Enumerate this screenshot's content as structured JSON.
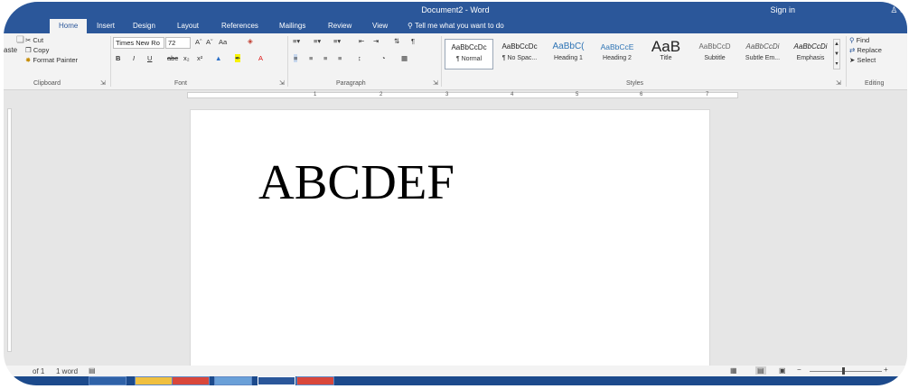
{
  "window": {
    "title": "Document2 - Word",
    "sign_in": "Sign in",
    "share_initial": "S"
  },
  "tabs": [
    "Home",
    "Insert",
    "Design",
    "Layout",
    "References",
    "Mailings",
    "Review",
    "View"
  ],
  "tell_me": "Tell me what you want to do",
  "clipboard": {
    "paste": "aste",
    "cut": "Cut",
    "copy": "Copy",
    "format_painter": "Format Painter"
  },
  "font": {
    "name": "Times New Ro",
    "size": "72",
    "grow": "Aˆ",
    "shrink": "Aˇ",
    "case": "Aa",
    "bold": "B",
    "italic": "I",
    "underline": "U",
    "strike": "abc",
    "subscript": "x₂",
    "superscript": "x²",
    "color_a": "A"
  },
  "paragraph": {
    "marks": "¶"
  },
  "styles": [
    {
      "preview": "AaBbCcDc",
      "name": "¶ Normal"
    },
    {
      "preview": "AaBbCcDc",
      "name": "¶ No Spac..."
    },
    {
      "preview": "AaBbC(",
      "name": "Heading 1"
    },
    {
      "preview": "AaBbCcE",
      "name": "Heading 2"
    },
    {
      "preview": "AaB",
      "name": "Title"
    },
    {
      "preview": "AaBbCcD",
      "name": "Subtitle"
    },
    {
      "preview": "AaBbCcDi",
      "name": "Subtle Em..."
    },
    {
      "preview": "AaBbCcDi",
      "name": "Emphasis"
    }
  ],
  "editing": {
    "find": "Find",
    "replace": "Replace",
    "select": "Select"
  },
  "groups": {
    "clipboard": "Clipboard",
    "font": "Font",
    "paragraph": "Paragraph",
    "styles": "Styles",
    "editing": "Editing"
  },
  "ruler": [
    "1",
    "2",
    "3",
    "4",
    "5",
    "6",
    "7"
  ],
  "document": {
    "text": "ABCDEF"
  },
  "status": {
    "page": "of 1",
    "words": "1 word",
    "zoom_out": "−",
    "zoom_in": "+"
  }
}
